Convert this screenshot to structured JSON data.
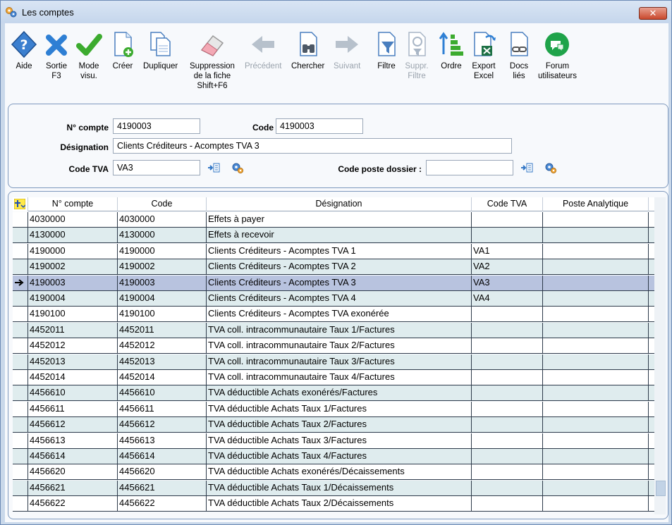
{
  "window": {
    "title": "Les comptes",
    "close_label": "✕"
  },
  "toolbar": [
    {
      "name": "aide",
      "label": "Aide",
      "icon": "help-diamond-icon",
      "disabled": false
    },
    {
      "name": "sortie",
      "label": "Sortie\nF3",
      "icon": "exit-x-icon",
      "disabled": false
    },
    {
      "name": "mode-visu",
      "label": "Mode\nvisu.",
      "icon": "check-icon",
      "disabled": false
    },
    {
      "name": "creer",
      "label": "Créer",
      "icon": "new-document-icon",
      "disabled": false
    },
    {
      "name": "dupliquer",
      "label": "Dupliquer",
      "icon": "duplicate-icon",
      "disabled": false
    },
    {
      "name": "suppression",
      "label": "Suppression\nde la fiche\nShift+F6",
      "icon": "eraser-icon",
      "disabled": false
    },
    {
      "name": "precedent",
      "label": "Précédent",
      "icon": "arrow-left-icon",
      "disabled": true
    },
    {
      "name": "chercher",
      "label": "Chercher",
      "icon": "binoculars-icon",
      "disabled": false
    },
    {
      "name": "suivant",
      "label": "Suivant",
      "icon": "arrow-right-icon",
      "disabled": true
    },
    {
      "name": "filtre",
      "label": "Filtre",
      "icon": "filter-icon",
      "disabled": false
    },
    {
      "name": "suppr-filtre",
      "label": "Suppr.\nFiltre",
      "icon": "remove-filter-icon",
      "disabled": true
    },
    {
      "name": "ordre",
      "label": "Ordre",
      "icon": "sort-order-icon",
      "disabled": false
    },
    {
      "name": "export-excel",
      "label": "Export\nExcel",
      "icon": "excel-export-icon",
      "disabled": false
    },
    {
      "name": "docs-lies",
      "label": "Docs\nliés",
      "icon": "linked-docs-icon",
      "disabled": false
    },
    {
      "name": "forum",
      "label": "Forum\nutilisateurs",
      "icon": "forum-chat-icon",
      "disabled": false
    }
  ],
  "form": {
    "num_compte_label": "N° compte",
    "num_compte_value": "4190003",
    "code_label": "Code",
    "code_value": "4190003",
    "designation_label": "Désignation",
    "designation_value": "Clients Créditeurs - Acomptes TVA 3",
    "code_tva_label": "Code TVA",
    "code_tva_value": "VA3",
    "code_poste_label": "Code poste dossier :",
    "code_poste_value": ""
  },
  "grid": {
    "columns": [
      "N° compte",
      "Code",
      "Désignation",
      "Code TVA",
      "Poste Analytique"
    ],
    "selected_index": 4,
    "rows": [
      [
        "4030000",
        "4030000",
        "Effets à payer",
        "",
        ""
      ],
      [
        "4130000",
        "4130000",
        "Effets à recevoir",
        "",
        ""
      ],
      [
        "4190000",
        "4190000",
        "Clients Créditeurs - Acomptes TVA 1",
        "VA1",
        ""
      ],
      [
        "4190002",
        "4190002",
        "Clients Créditeurs - Acomptes TVA 2",
        "VA2",
        ""
      ],
      [
        "4190003",
        "4190003",
        "Clients Créditeurs - Acomptes TVA 3",
        "VA3",
        ""
      ],
      [
        "4190004",
        "4190004",
        "Clients Créditeurs - Acomptes TVA 4",
        "VA4",
        ""
      ],
      [
        "4190100",
        "4190100",
        "Clients Créditeurs - Acomptes TVA exonérée",
        "",
        ""
      ],
      [
        "4452011",
        "4452011",
        "TVA coll. intracommunautaire Taux 1/Factures",
        "",
        ""
      ],
      [
        "4452012",
        "4452012",
        "TVA coll. intracommunautaire Taux 2/Factures",
        "",
        ""
      ],
      [
        "4452013",
        "4452013",
        "TVA coll. intracommunautaire Taux 3/Factures",
        "",
        ""
      ],
      [
        "4452014",
        "4452014",
        "TVA coll. intracommunautaire Taux 4/Factures",
        "",
        ""
      ],
      [
        "4456610",
        "4456610",
        "TVA déductible Achats exonérés/Factures",
        "",
        ""
      ],
      [
        "4456611",
        "4456611",
        "TVA déductible Achats Taux 1/Factures",
        "",
        ""
      ],
      [
        "4456612",
        "4456612",
        "TVA déductible Achats Taux 2/Factures",
        "",
        ""
      ],
      [
        "4456613",
        "4456613",
        "TVA déductible Achats Taux 3/Factures",
        "",
        ""
      ],
      [
        "4456614",
        "4456614",
        "TVA déductible Achats Taux 4/Factures",
        "",
        ""
      ],
      [
        "4456620",
        "4456620",
        "TVA déductible Achats exonérés/Décaissements",
        "",
        ""
      ],
      [
        "4456621",
        "4456621",
        "TVA déductible Achats Taux 1/Décaissements",
        "",
        ""
      ],
      [
        "4456622",
        "4456622",
        "TVA déductible Achats Taux 2/Décaissements",
        "",
        ""
      ]
    ]
  }
}
